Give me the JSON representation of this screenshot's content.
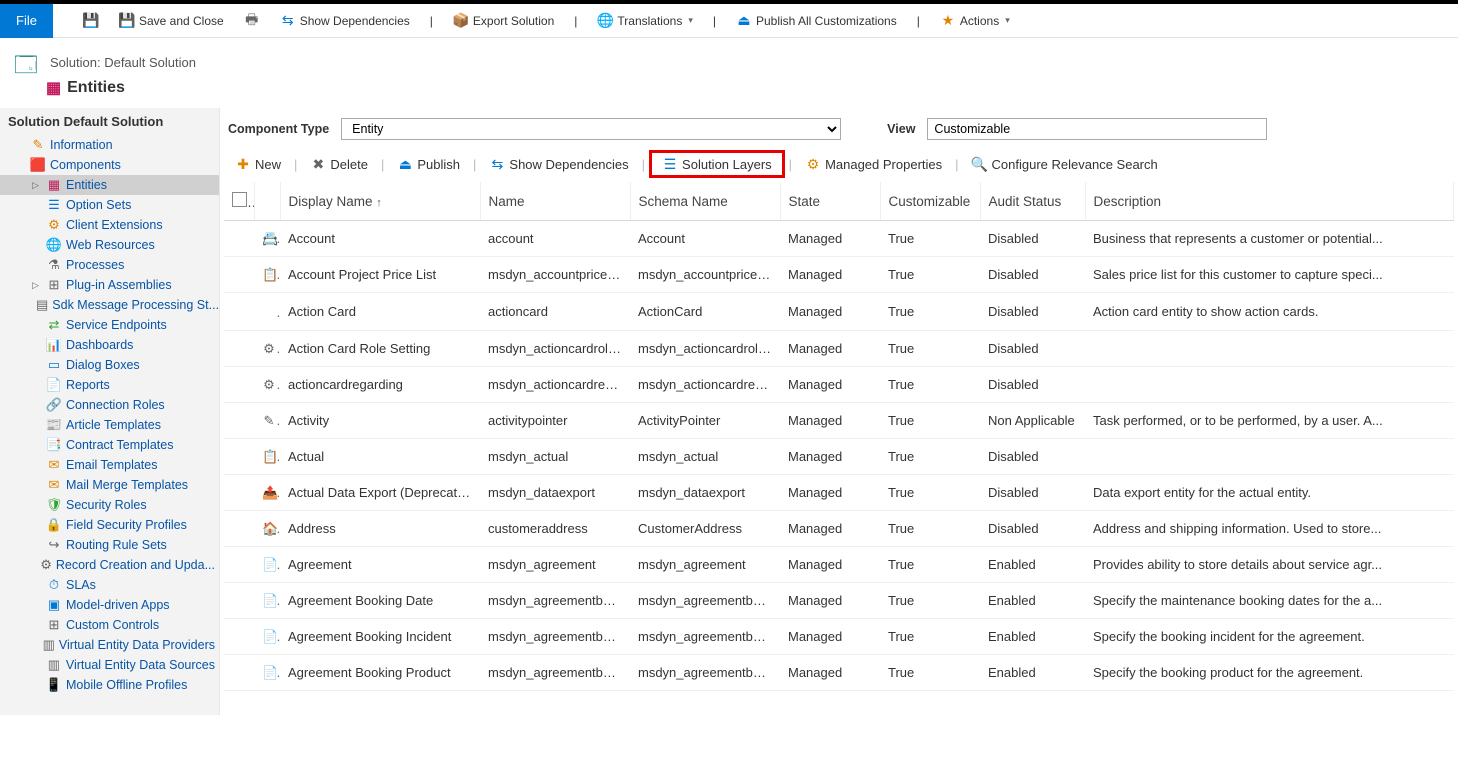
{
  "ribbon": {
    "file": "File",
    "saveClose": "Save and Close",
    "showDeps": "Show Dependencies",
    "exportSol": "Export Solution",
    "translations": "Translations",
    "publishAll": "Publish All Customizations",
    "actions": "Actions"
  },
  "header": {
    "breadcrumb": "Solution: Default Solution",
    "title": "Entities"
  },
  "sidebar": {
    "title": "Solution Default Solution",
    "information": "Information",
    "components": "Components",
    "children": {
      "entities": "Entities",
      "optionSets": "Option Sets",
      "clientExtensions": "Client Extensions",
      "webResources": "Web Resources",
      "processes": "Processes",
      "pluginAssemblies": "Plug-in Assemblies",
      "sdkSteps": "Sdk Message Processing St...",
      "serviceEndpoints": "Service Endpoints",
      "dashboards": "Dashboards",
      "dialogBoxes": "Dialog Boxes",
      "reports": "Reports",
      "connectionRoles": "Connection Roles",
      "articleTemplates": "Article Templates",
      "contractTemplates": "Contract Templates",
      "emailTemplates": "Email Templates",
      "mailMerge": "Mail Merge Templates",
      "securityRoles": "Security Roles",
      "fieldSecurity": "Field Security Profiles",
      "routingRuleSets": "Routing Rule Sets",
      "recordCreation": "Record Creation and Upda...",
      "slas": "SLAs",
      "modelDrivenApps": "Model-driven Apps",
      "customControls": "Custom Controls",
      "virtualProviders": "Virtual Entity Data Providers",
      "virtualSources": "Virtual Entity Data Sources",
      "mobileOffline": "Mobile Offline Profiles"
    }
  },
  "filter": {
    "componentTypeLabel": "Component Type",
    "componentType": "Entity",
    "viewLabel": "View",
    "view": "Customizable"
  },
  "subToolbar": {
    "new": "New",
    "delete": "Delete",
    "publish": "Publish",
    "showDeps": "Show Dependencies",
    "solutionLayers": "Solution Layers",
    "managedProps": "Managed Properties",
    "configureRelevance": "Configure Relevance Search"
  },
  "grid": {
    "headers": {
      "displayName": "Display Name",
      "name": "Name",
      "schemaName": "Schema Name",
      "state": "State",
      "customizable": "Customizable",
      "auditStatus": "Audit Status",
      "description": "Description"
    },
    "rows": [
      {
        "display": "Account",
        "name": "account",
        "schema": "Account",
        "state": "Managed",
        "cust": "True",
        "audit": "Disabled",
        "desc": "Business that represents a customer or potential..."
      },
      {
        "display": "Account Project Price List",
        "name": "msdyn_accountpricelist",
        "schema": "msdyn_accountpricelist",
        "state": "Managed",
        "cust": "True",
        "audit": "Disabled",
        "desc": "Sales price list for this customer to capture speci..."
      },
      {
        "display": "Action Card",
        "name": "actioncard",
        "schema": "ActionCard",
        "state": "Managed",
        "cust": "True",
        "audit": "Disabled",
        "desc": "Action card entity to show action cards."
      },
      {
        "display": "Action Card Role Setting",
        "name": "msdyn_actioncardrole...",
        "schema": "msdyn_actioncardrole...",
        "state": "Managed",
        "cust": "True",
        "audit": "Disabled",
        "desc": ""
      },
      {
        "display": "actioncardregarding",
        "name": "msdyn_actioncardrega...",
        "schema": "msdyn_actioncardrega...",
        "state": "Managed",
        "cust": "True",
        "audit": "Disabled",
        "desc": ""
      },
      {
        "display": "Activity",
        "name": "activitypointer",
        "schema": "ActivityPointer",
        "state": "Managed",
        "cust": "True",
        "audit": "Non Applicable",
        "desc": "Task performed, or to be performed, by a user. A..."
      },
      {
        "display": "Actual",
        "name": "msdyn_actual",
        "schema": "msdyn_actual",
        "state": "Managed",
        "cust": "True",
        "audit": "Disabled",
        "desc": ""
      },
      {
        "display": "Actual Data Export (Deprecated)",
        "name": "msdyn_dataexport",
        "schema": "msdyn_dataexport",
        "state": "Managed",
        "cust": "True",
        "audit": "Disabled",
        "desc": "Data export entity for the actual entity."
      },
      {
        "display": "Address",
        "name": "customeraddress",
        "schema": "CustomerAddress",
        "state": "Managed",
        "cust": "True",
        "audit": "Disabled",
        "desc": "Address and shipping information. Used to store..."
      },
      {
        "display": "Agreement",
        "name": "msdyn_agreement",
        "schema": "msdyn_agreement",
        "state": "Managed",
        "cust": "True",
        "audit": "Enabled",
        "desc": "Provides ability to store details about service agr..."
      },
      {
        "display": "Agreement Booking Date",
        "name": "msdyn_agreementboo...",
        "schema": "msdyn_agreementboo...",
        "state": "Managed",
        "cust": "True",
        "audit": "Enabled",
        "desc": "Specify the maintenance booking dates for the a..."
      },
      {
        "display": "Agreement Booking Incident",
        "name": "msdyn_agreementboo...",
        "schema": "msdyn_agreementboo...",
        "state": "Managed",
        "cust": "True",
        "audit": "Enabled",
        "desc": "Specify the booking incident for the agreement."
      },
      {
        "display": "Agreement Booking Product",
        "name": "msdyn_agreementboo...",
        "schema": "msdyn_agreementboo...",
        "state": "Managed",
        "cust": "True",
        "audit": "Enabled",
        "desc": "Specify the booking product for the agreement."
      }
    ]
  }
}
